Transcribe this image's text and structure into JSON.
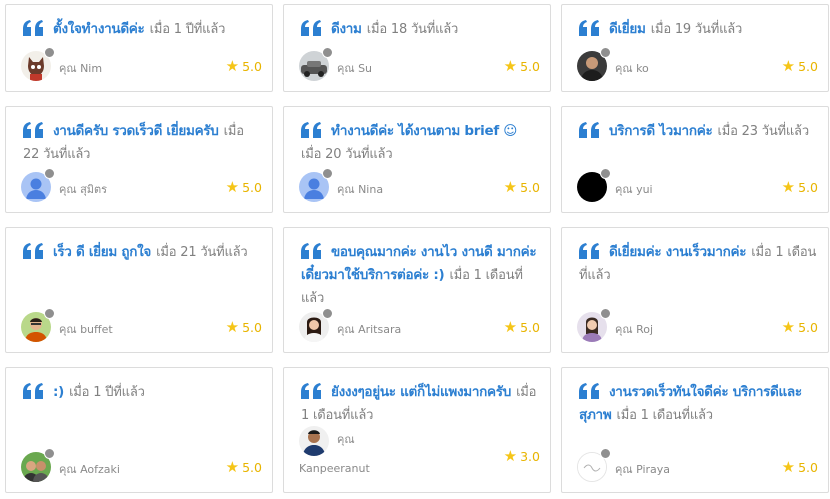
{
  "colors": {
    "accent_blue": "#2c7fd1",
    "star_yellow": "#f5c518",
    "status_gray": "#8f8f8f"
  },
  "reviews": [
    {
      "text": "ตั้งใจทำงานดีค่ะ",
      "time": "เมื่อ 1 ปีที่แล้ว",
      "prefix": "คุณ",
      "name": "Nim",
      "rating": "5.0",
      "avatar": "cartoon-avatar"
    },
    {
      "text": "ดีงาม",
      "time": "เมื่อ 18 วันที่แล้ว",
      "prefix": "คุณ",
      "name": "Su",
      "rating": "5.0",
      "avatar": "car-photo-avatar"
    },
    {
      "text": "ดีเยี่ยม",
      "time": "เมื่อ 19 วันที่แล้ว",
      "prefix": "คุณ",
      "name": "ko",
      "rating": "5.0",
      "avatar": "person-photo-avatar"
    },
    {
      "text": "งานดีครับ รวดเร็วดี เยี่ยมครับ",
      "time": "เมื่อ 22 วันที่แล้ว",
      "prefix": "คุณ",
      "name": "สุมิตร",
      "rating": "5.0",
      "avatar": "default-user-avatar"
    },
    {
      "text": "ทำงานดีค่ะ ได้งานตาม brief ☺",
      "time": "เมื่อ 20 วันที่แล้ว",
      "prefix": "คุณ",
      "name": "Nina",
      "rating": "5.0",
      "avatar": "default-user-avatar"
    },
    {
      "text": "บริการดี ไวมากค่ะ",
      "time": "เมื่อ 23 วันที่แล้ว",
      "prefix": "คุณ",
      "name": "yui",
      "rating": "5.0",
      "avatar": "black-avatar"
    },
    {
      "text": "เร็ว ดี เยี่ยม ถูกใจ",
      "time": "เมื่อ 21 วันที่แล้ว",
      "prefix": "คุณ",
      "name": "buffet",
      "rating": "5.0",
      "avatar": "person-photo-avatar"
    },
    {
      "text": "ขอบคุณมากค่ะ งานไว งานดี มากค่ะ เดี๋ยวมาใช้บริการต่อค่ะ :)",
      "time": "เมื่อ 1 เดือนที่แล้ว",
      "prefix": "คุณ",
      "name": "Aritsara",
      "rating": "5.0",
      "avatar": "person-photo-avatar"
    },
    {
      "text": "ดีเยี่ยมค่ะ งานเร็วมากค่ะ",
      "time": "เมื่อ 1 เดือนที่แล้ว",
      "prefix": "คุณ",
      "name": "Roj",
      "rating": "5.0",
      "avatar": "person-photo-avatar"
    },
    {
      "text": ":)",
      "time": "เมื่อ 1 ปีที่แล้ว",
      "prefix": "คุณ",
      "name": "Aofzaki",
      "rating": "5.0",
      "avatar": "person-photo-avatar"
    },
    {
      "text": "ยังงงๆอยู่นะ แต่ก็ไม่แพงมากครับ",
      "time": "เมื่อ 1 เดือนที่แล้ว",
      "prefix": "คุณ",
      "name": "Kanpeeranut",
      "rating": "3.0",
      "avatar": "person-photo-avatar"
    },
    {
      "text": "งานรวดเร็วทันใจดีค่ะ บริการดีและสุภาพ",
      "time": "เมื่อ 1 เดือนที่แล้ว",
      "prefix": "คุณ",
      "name": "Piraya",
      "rating": "5.0",
      "avatar": "logo-avatar"
    }
  ]
}
